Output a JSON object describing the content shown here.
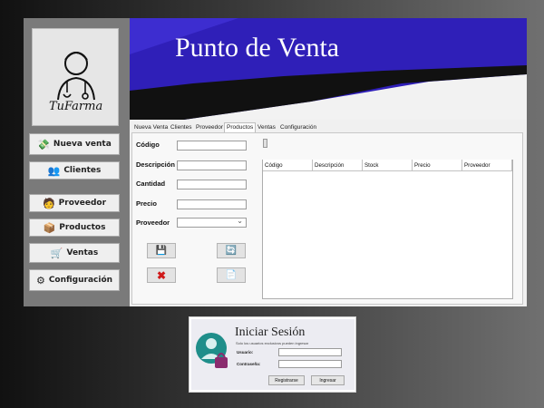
{
  "app": {
    "title": "Punto de Venta",
    "logo_text": "TuFarma"
  },
  "sidebar": {
    "items": [
      {
        "label": "Nueva venta",
        "icon": "cash-hand-icon"
      },
      {
        "label": "Clientes",
        "icon": "people-icon"
      },
      {
        "label": "Proveedor",
        "icon": "delivery-person-icon"
      },
      {
        "label": "Productos",
        "icon": "box-icon"
      },
      {
        "label": "Ventas",
        "icon": "cart-icon"
      },
      {
        "label": "Configuración",
        "icon": "gear-icon"
      }
    ]
  },
  "tabs": [
    {
      "label": "Nueva Venta"
    },
    {
      "label": "Clientes"
    },
    {
      "label": "Proveedor"
    },
    {
      "label": "Productos",
      "active": true
    },
    {
      "label": "Ventas"
    },
    {
      "label": "Configuración"
    }
  ],
  "form": {
    "codigo_label": "Código",
    "descripcion_label": "Descripción",
    "cantidad_label": "Cantidad",
    "precio_label": "Precio",
    "proveedor_label": "Proveedor"
  },
  "table": {
    "columns": [
      "Código",
      "Descripción",
      "Stock",
      "Precio",
      "Proveedor"
    ]
  },
  "actions": {
    "icons": [
      "save-icon",
      "update-icon",
      "delete-icon",
      "new-icon"
    ]
  },
  "login": {
    "title": "Iniciar Sesión",
    "subtitle": "Solo los usuarios exclusivos pueden ingresar",
    "user_label": "Usuario:",
    "password_label": "Contraseña:",
    "register_label": "Registrarse",
    "login_label": "Ingresar"
  },
  "colors": {
    "banner_blue": "#2f1fb8",
    "banner_dark": "#111111",
    "panel_bg": "#f8f8f8"
  }
}
